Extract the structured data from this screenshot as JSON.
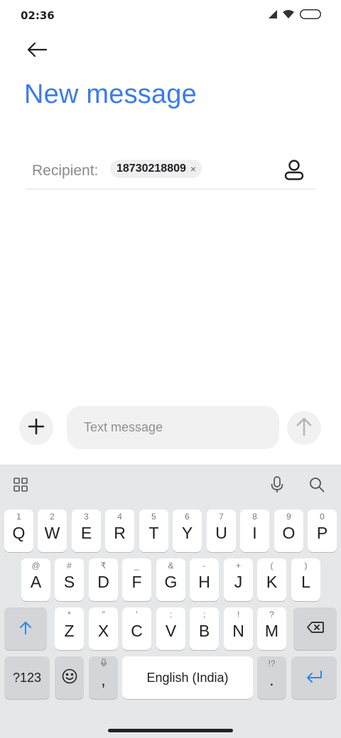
{
  "status_bar": {
    "time": "02:36"
  },
  "header": {
    "title": "New message"
  },
  "recipient": {
    "label": "Recipient:",
    "chip": "18730218809",
    "chip_close": "×"
  },
  "compose": {
    "placeholder": "Text message"
  },
  "keyboard": {
    "row1": [
      {
        "main": "Q",
        "hint": "1"
      },
      {
        "main": "W",
        "hint": "2"
      },
      {
        "main": "E",
        "hint": "3"
      },
      {
        "main": "R",
        "hint": "4"
      },
      {
        "main": "T",
        "hint": "5"
      },
      {
        "main": "Y",
        "hint": "6"
      },
      {
        "main": "U",
        "hint": "7"
      },
      {
        "main": "I",
        "hint": "8"
      },
      {
        "main": "O",
        "hint": "9"
      },
      {
        "main": "P",
        "hint": "0"
      }
    ],
    "row2": [
      {
        "main": "A",
        "hint": "@"
      },
      {
        "main": "S",
        "hint": "#"
      },
      {
        "main": "D",
        "hint": "₹"
      },
      {
        "main": "F",
        "hint": "_"
      },
      {
        "main": "G",
        "hint": "&"
      },
      {
        "main": "H",
        "hint": "-"
      },
      {
        "main": "J",
        "hint": "+"
      },
      {
        "main": "K",
        "hint": "("
      },
      {
        "main": "L",
        "hint": ")"
      }
    ],
    "row3": [
      {
        "main": "Z",
        "hint": "*"
      },
      {
        "main": "X",
        "hint": "\""
      },
      {
        "main": "C",
        "hint": "'"
      },
      {
        "main": "V",
        "hint": ":"
      },
      {
        "main": "B",
        "hint": ";"
      },
      {
        "main": "N",
        "hint": "!"
      },
      {
        "main": "M",
        "hint": "?"
      }
    ],
    "symbols_label": "?123",
    "comma": ",",
    "space_label": "English (India)",
    "period": ".",
    "period_hint": "!?"
  },
  "colors": {
    "accent": "#3d7bea",
    "keyboard_bg": "#e6e7e9",
    "key_bg": "#ffffff",
    "special_key_bg": "#d3d5d8",
    "enter_icon": "#2d8be0"
  },
  "icons": [
    "back-arrow-icon",
    "signal-icon",
    "wifi-icon",
    "battery-icon",
    "contact-icon",
    "plus-icon",
    "send-arrow-icon",
    "apps-grid-icon",
    "mic-icon",
    "search-icon",
    "shift-icon",
    "backspace-icon",
    "emoji-icon",
    "enter-icon"
  ]
}
